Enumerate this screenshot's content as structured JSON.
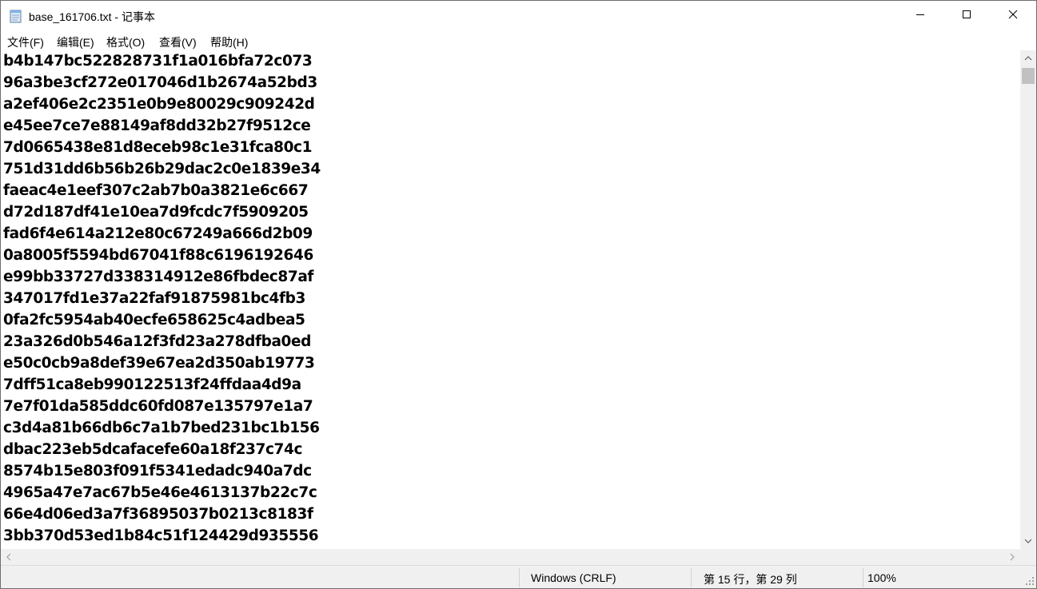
{
  "window": {
    "title": "base_161706.txt - 记事本",
    "controls": {
      "minimize": "minimize-icon",
      "maximize": "maximize-icon",
      "close": "close-icon"
    }
  },
  "menu": {
    "items": [
      {
        "label": "文件(F)"
      },
      {
        "label": "编辑(E)"
      },
      {
        "label": "格式(O)"
      },
      {
        "label": "查看(V)"
      },
      {
        "label": "帮助(H)"
      }
    ]
  },
  "editor": {
    "lines": [
      "b4b147bc522828731f1a016bfa72c073",
      "96a3be3cf272e017046d1b2674a52bd3",
      "a2ef406e2c2351e0b9e80029c909242d",
      "e45ee7ce7e88149af8dd32b27f9512ce",
      "7d0665438e81d8eceb98c1e31fca80c1",
      "751d31dd6b56b26b29dac2c0e1839e34",
      "faeac4e1eef307c2ab7b0a3821e6c667",
      "d72d187df41e10ea7d9fcdc7f5909205",
      "fad6f4e614a212e80c67249a666d2b09",
      "0a8005f5594bd67041f88c6196192646",
      "e99bb33727d338314912e86fbdec87af",
      "347017fd1e37a22faf91875981bc4fb3",
      "0fa2fc5954ab40ecfe658625c4adbea5",
      "23a326d0b546a12f3fd23a278dfba0ed",
      "e50c0cb9a8def39e67ea2d350ab19773",
      "7dff51ca8eb990122513f24ffdaa4d9a",
      "7e7f01da585ddc60fd087e135797e1a7",
      "c3d4a81b66db6c7a1b7bed231bc1b156",
      "dbac223eb5dcafacefe60a18f237c74c",
      "8574b15e803f091f5341edadc940a7dc",
      "4965a47e7ac67b5e46e4613137b22c7c",
      "66e4d06ed3a7f36895037b0213c8183f",
      "3bb370d53ed1b84c51f124429d935556"
    ]
  },
  "status": {
    "encoding": "Windows (CRLF)",
    "position": "第 15 行，第 29 列",
    "zoom": "100%"
  },
  "colors": {
    "chrome_bg": "#f0f0f0",
    "scroll_thumb": "#c1c1c1",
    "text": "#000000"
  }
}
